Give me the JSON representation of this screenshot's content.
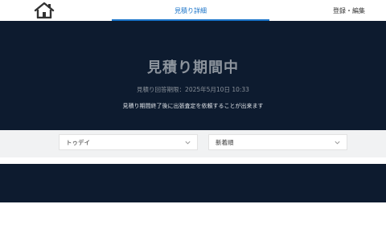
{
  "header": {
    "home_icon": "home-icon",
    "active_tab_label": "見積り詳細",
    "edit_tab_label": "登録・編集"
  },
  "hero": {
    "title": "見積り期間中",
    "deadline": "見積り回答期限：2025年5月10日 10:33",
    "note": "見積り期間終了後に出張査定を依頼することが出来ます"
  },
  "filters": {
    "shop_selected": "トゥデイ",
    "sort_selected": "新着順"
  },
  "colors": {
    "hero_bg": "#0d1b2f",
    "accent": "#1a73c8",
    "filter_bg": "#f1f2f3"
  }
}
